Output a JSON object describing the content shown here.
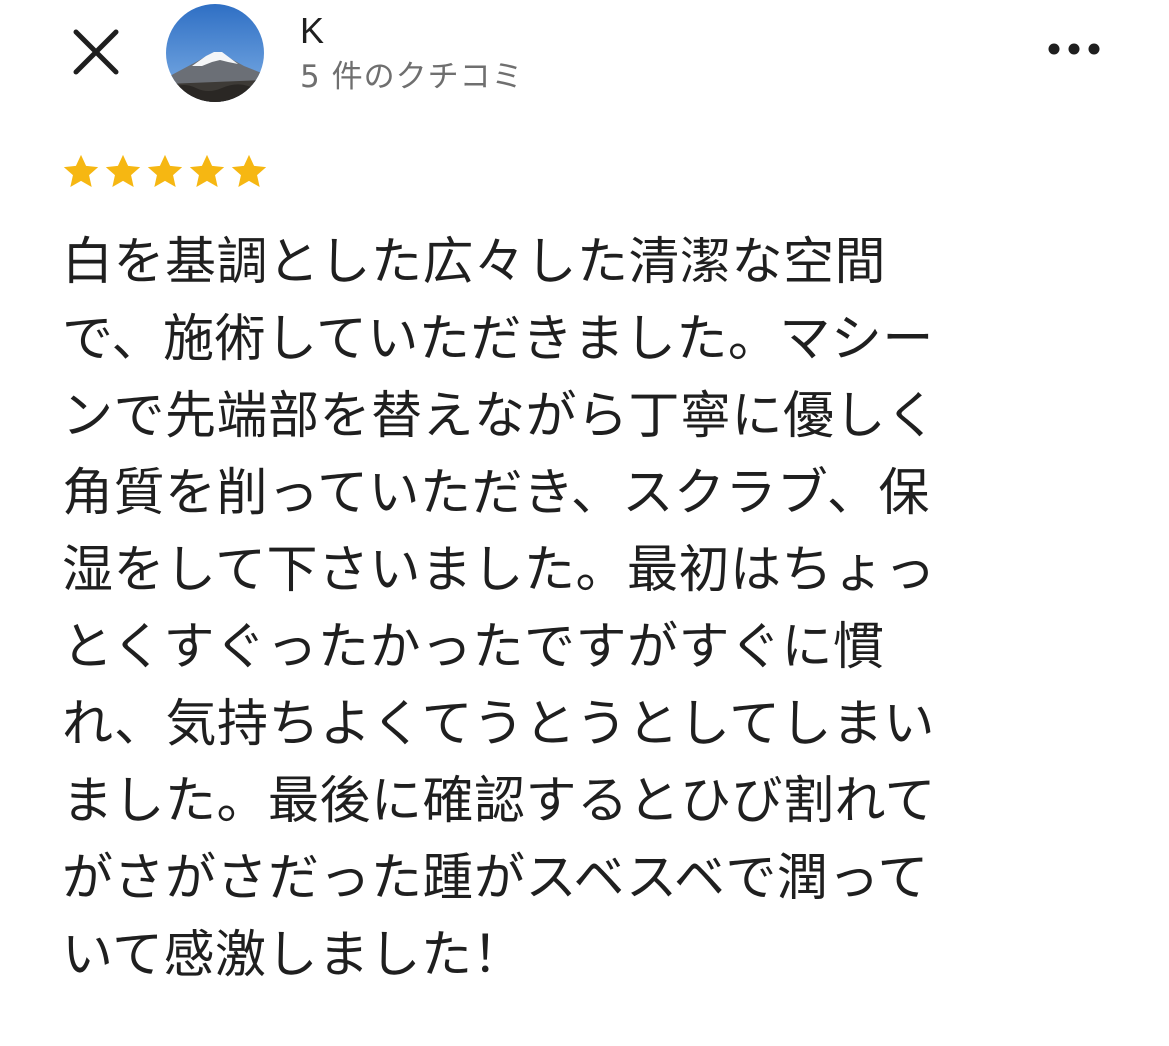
{
  "header": {
    "close_icon": "close-icon",
    "avatar_icon": "mountain-avatar",
    "user_name": "K",
    "review_count": "5 件のクチコミ",
    "more_icon": "more-horizontal-icon"
  },
  "rating": {
    "value": 5,
    "max": 5,
    "star_color": "#f6b712"
  },
  "review": {
    "lines": [
      "白を基調とした広々した清潔な空間",
      "で、施術していただきました。マシー",
      "ンで先端部を替えながら丁寧に優しく",
      "角質を削っていただき、スクラブ、保",
      "湿をして下さいました。最初はちょっ",
      "とくすぐったかったですがすぐに慣",
      "れ、気持ちよくてうとうとしてしまい",
      "ました。最後に確認するとひび割れて",
      "がさがさだった踵がスベスベで潤って",
      "いて感激しました！"
    ]
  }
}
